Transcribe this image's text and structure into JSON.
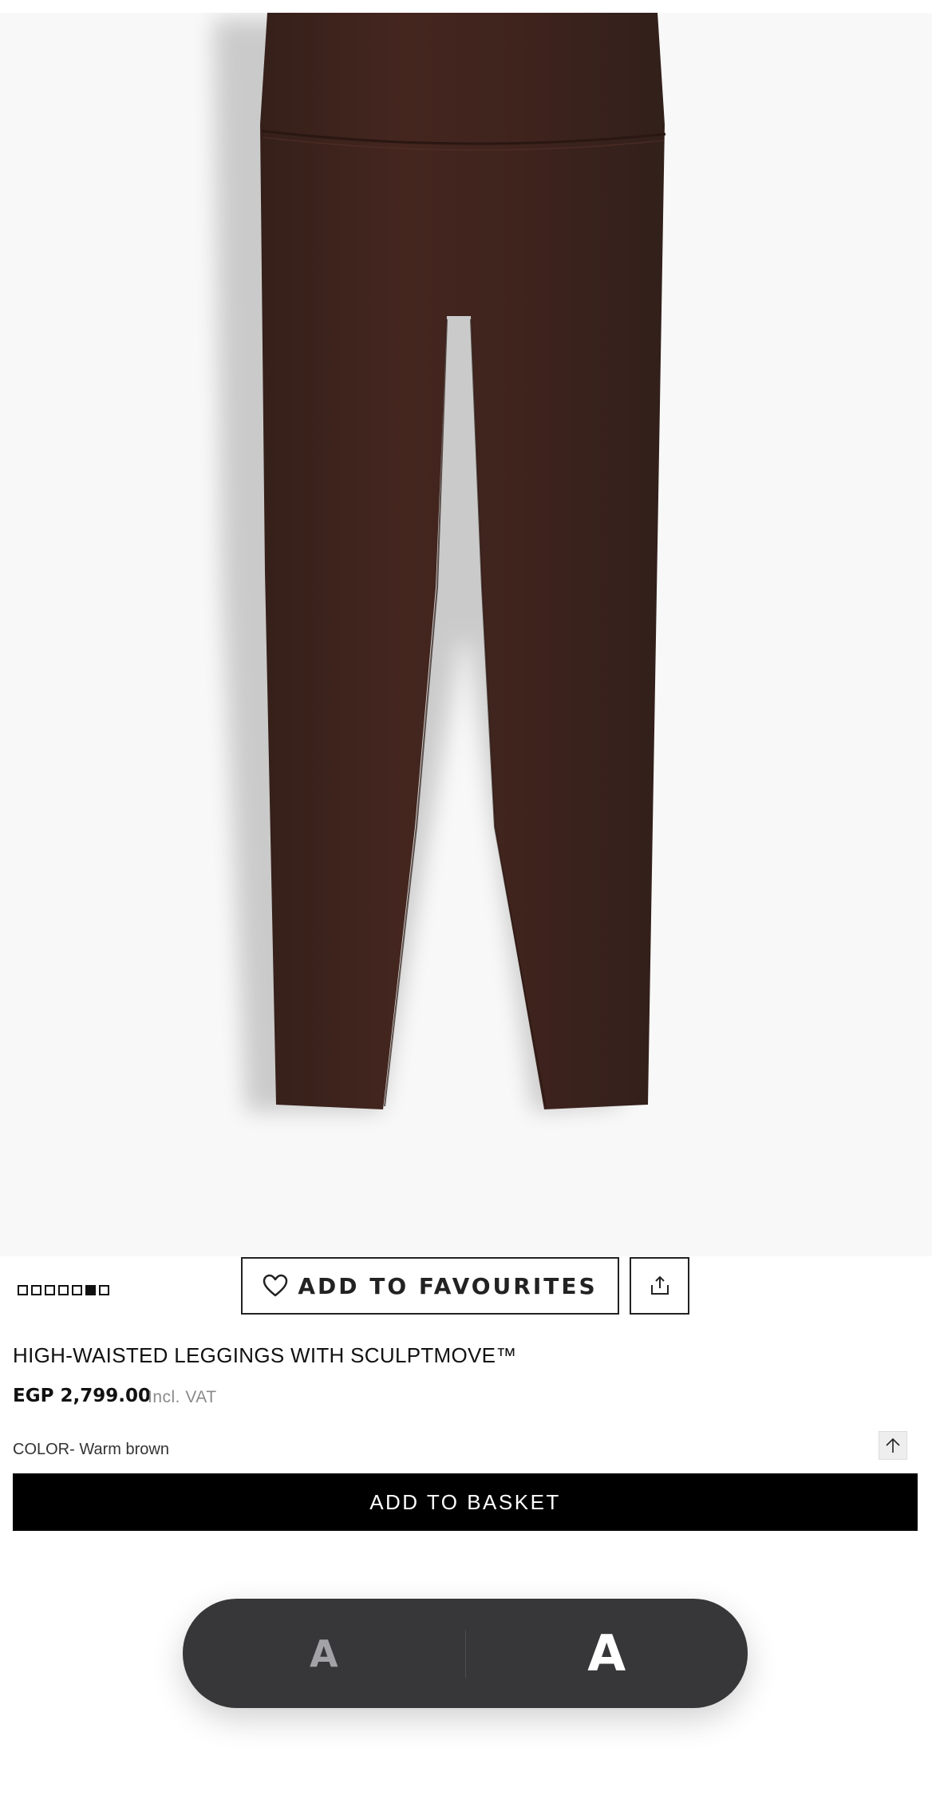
{
  "product": {
    "image_alt": "HIGH-WAISTED LEGGINGS WITH SCULPTMOVE™",
    "title": "HIGH-WAISTED LEGGINGS WITH SCULPTMOVE™",
    "price": "EGP 2,799.00",
    "vat_note": "Incl. VAT",
    "color_label": "COLOR- Warm brown",
    "color_hex": "#3e221e"
  },
  "gallery": {
    "total_images": 7,
    "active_index": 5
  },
  "actions": {
    "favourites_label": "ADD TO FAVOURITES",
    "favourites_icon": "heart-icon",
    "share_icon": "share-icon",
    "scroll_top_icon": "arrow-up-icon",
    "add_to_basket_label": "ADD TO BASKET"
  },
  "font_size_control": {
    "small_label": "A",
    "large_label": "A",
    "selected": "large"
  }
}
